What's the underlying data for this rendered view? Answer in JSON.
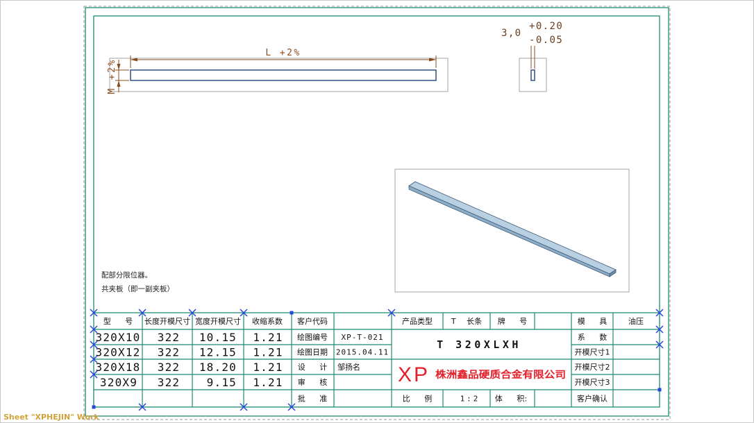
{
  "sheet": {
    "label": "Sheet \"XPHEJIN\" Work"
  },
  "colors": {
    "frame": "#1b8a74",
    "dimension": "#8a4b1c",
    "part_edge": "#3a5a8a",
    "part_fill": "#b9d0e2",
    "sketch_point": "#2747d8",
    "logo": "#e3202a",
    "sheet_label": "#d2a23a"
  },
  "front_view": {
    "length_dim": "L +2%",
    "width_dim": "M +2%"
  },
  "section_view": {
    "slot_dim": "3,0",
    "upper_tol": "+0.20",
    "lower_tol": "-0.05"
  },
  "notes": [
    "配部分限位器。",
    "共夹板（即一副夹板）"
  ],
  "title_block": {
    "spec_headers": [
      "型 号",
      "长度开模尺寸",
      "宽度开模尺寸",
      "收缩系数"
    ],
    "spec_rows": [
      {
        "model": "320X10",
        "length": "322",
        "width": "10.15",
        "shrink": "1.21"
      },
      {
        "model": "320X12",
        "length": "322",
        "width": "12.15",
        "shrink": "1.21"
      },
      {
        "model": "320X18",
        "length": "322",
        "width": "18.20",
        "shrink": "1.21"
      },
      {
        "model": "320X9",
        "length": "322",
        "width": "9.15",
        "shrink": "1.21"
      }
    ],
    "info": [
      {
        "label": "客户代码"
      },
      {
        "label": "绘图编号",
        "value": "XP-T-021"
      },
      {
        "label": "绘图日期",
        "value": "2015.04.11"
      },
      {
        "label": "设 计",
        "value": "邹扬名"
      },
      {
        "label": "审 核"
      },
      {
        "label": "批 准"
      }
    ],
    "product_type": {
      "label": "产品类型",
      "value": "T 长条"
    },
    "grade": {
      "label": "牌 号"
    },
    "part_name": "T 320XLXH",
    "logo": "XP",
    "company": "株洲鑫品硬质合金有限公司",
    "scale": {
      "label": "比 例",
      "value": "1:2"
    },
    "volume": {
      "label": "体 积:"
    },
    "mold": {
      "label": "模 具",
      "value": "油压"
    },
    "right_labels": [
      "系 数",
      "开模尺寸1",
      "开模尺寸2",
      "开模尺寸3",
      "客户确认"
    ]
  }
}
